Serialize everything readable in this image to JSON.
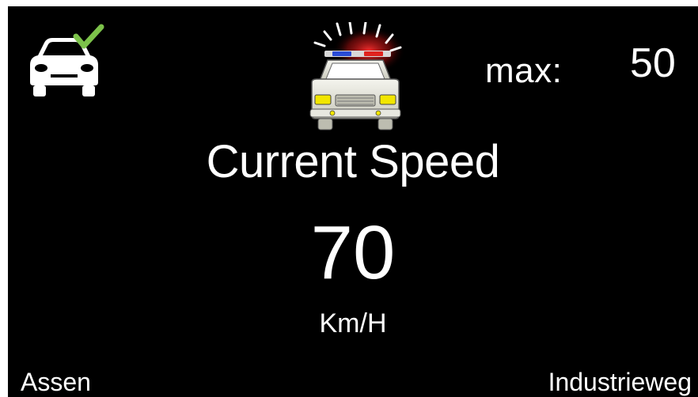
{
  "status": {
    "car_icon": "car-check-icon",
    "check_color": "#7cc24a"
  },
  "alert": {
    "icon": "police-car-icon",
    "siren_colors": [
      "#e0231f",
      "#2a4bd6"
    ]
  },
  "limit": {
    "label": "max:",
    "value": "50"
  },
  "main": {
    "title": "Current Speed",
    "speed": "70",
    "unit": "Km/H"
  },
  "location": {
    "city": "Assen",
    "street": "Industrieweg"
  }
}
